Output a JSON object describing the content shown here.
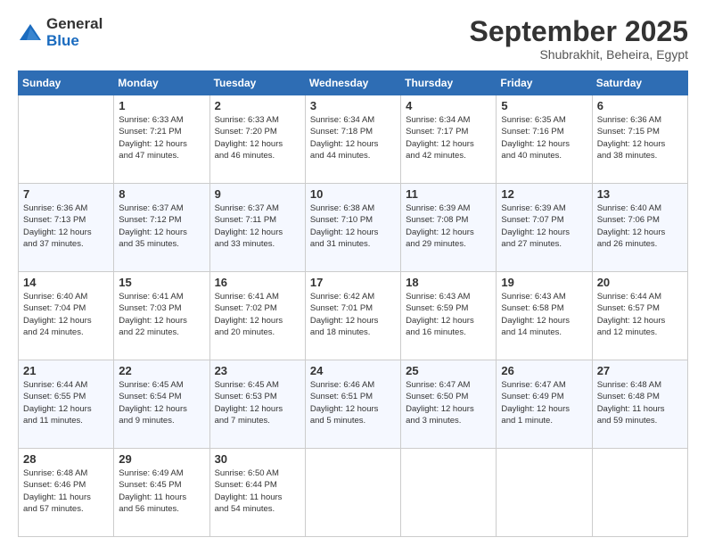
{
  "logo": {
    "general": "General",
    "blue": "Blue"
  },
  "header": {
    "month": "September 2025",
    "location": "Shubrakhit, Beheira, Egypt"
  },
  "days_header": [
    "Sunday",
    "Monday",
    "Tuesday",
    "Wednesday",
    "Thursday",
    "Friday",
    "Saturday"
  ],
  "weeks": [
    [
      {
        "day": "",
        "info": ""
      },
      {
        "day": "1",
        "info": "Sunrise: 6:33 AM\nSunset: 7:21 PM\nDaylight: 12 hours\nand 47 minutes."
      },
      {
        "day": "2",
        "info": "Sunrise: 6:33 AM\nSunset: 7:20 PM\nDaylight: 12 hours\nand 46 minutes."
      },
      {
        "day": "3",
        "info": "Sunrise: 6:34 AM\nSunset: 7:18 PM\nDaylight: 12 hours\nand 44 minutes."
      },
      {
        "day": "4",
        "info": "Sunrise: 6:34 AM\nSunset: 7:17 PM\nDaylight: 12 hours\nand 42 minutes."
      },
      {
        "day": "5",
        "info": "Sunrise: 6:35 AM\nSunset: 7:16 PM\nDaylight: 12 hours\nand 40 minutes."
      },
      {
        "day": "6",
        "info": "Sunrise: 6:36 AM\nSunset: 7:15 PM\nDaylight: 12 hours\nand 38 minutes."
      }
    ],
    [
      {
        "day": "7",
        "info": "Sunrise: 6:36 AM\nSunset: 7:13 PM\nDaylight: 12 hours\nand 37 minutes."
      },
      {
        "day": "8",
        "info": "Sunrise: 6:37 AM\nSunset: 7:12 PM\nDaylight: 12 hours\nand 35 minutes."
      },
      {
        "day": "9",
        "info": "Sunrise: 6:37 AM\nSunset: 7:11 PM\nDaylight: 12 hours\nand 33 minutes."
      },
      {
        "day": "10",
        "info": "Sunrise: 6:38 AM\nSunset: 7:10 PM\nDaylight: 12 hours\nand 31 minutes."
      },
      {
        "day": "11",
        "info": "Sunrise: 6:39 AM\nSunset: 7:08 PM\nDaylight: 12 hours\nand 29 minutes."
      },
      {
        "day": "12",
        "info": "Sunrise: 6:39 AM\nSunset: 7:07 PM\nDaylight: 12 hours\nand 27 minutes."
      },
      {
        "day": "13",
        "info": "Sunrise: 6:40 AM\nSunset: 7:06 PM\nDaylight: 12 hours\nand 26 minutes."
      }
    ],
    [
      {
        "day": "14",
        "info": "Sunrise: 6:40 AM\nSunset: 7:04 PM\nDaylight: 12 hours\nand 24 minutes."
      },
      {
        "day": "15",
        "info": "Sunrise: 6:41 AM\nSunset: 7:03 PM\nDaylight: 12 hours\nand 22 minutes."
      },
      {
        "day": "16",
        "info": "Sunrise: 6:41 AM\nSunset: 7:02 PM\nDaylight: 12 hours\nand 20 minutes."
      },
      {
        "day": "17",
        "info": "Sunrise: 6:42 AM\nSunset: 7:01 PM\nDaylight: 12 hours\nand 18 minutes."
      },
      {
        "day": "18",
        "info": "Sunrise: 6:43 AM\nSunset: 6:59 PM\nDaylight: 12 hours\nand 16 minutes."
      },
      {
        "day": "19",
        "info": "Sunrise: 6:43 AM\nSunset: 6:58 PM\nDaylight: 12 hours\nand 14 minutes."
      },
      {
        "day": "20",
        "info": "Sunrise: 6:44 AM\nSunset: 6:57 PM\nDaylight: 12 hours\nand 12 minutes."
      }
    ],
    [
      {
        "day": "21",
        "info": "Sunrise: 6:44 AM\nSunset: 6:55 PM\nDaylight: 12 hours\nand 11 minutes."
      },
      {
        "day": "22",
        "info": "Sunrise: 6:45 AM\nSunset: 6:54 PM\nDaylight: 12 hours\nand 9 minutes."
      },
      {
        "day": "23",
        "info": "Sunrise: 6:45 AM\nSunset: 6:53 PM\nDaylight: 12 hours\nand 7 minutes."
      },
      {
        "day": "24",
        "info": "Sunrise: 6:46 AM\nSunset: 6:51 PM\nDaylight: 12 hours\nand 5 minutes."
      },
      {
        "day": "25",
        "info": "Sunrise: 6:47 AM\nSunset: 6:50 PM\nDaylight: 12 hours\nand 3 minutes."
      },
      {
        "day": "26",
        "info": "Sunrise: 6:47 AM\nSunset: 6:49 PM\nDaylight: 12 hours\nand 1 minute."
      },
      {
        "day": "27",
        "info": "Sunrise: 6:48 AM\nSunset: 6:48 PM\nDaylight: 11 hours\nand 59 minutes."
      }
    ],
    [
      {
        "day": "28",
        "info": "Sunrise: 6:48 AM\nSunset: 6:46 PM\nDaylight: 11 hours\nand 57 minutes."
      },
      {
        "day": "29",
        "info": "Sunrise: 6:49 AM\nSunset: 6:45 PM\nDaylight: 11 hours\nand 56 minutes."
      },
      {
        "day": "30",
        "info": "Sunrise: 6:50 AM\nSunset: 6:44 PM\nDaylight: 11 hours\nand 54 minutes."
      },
      {
        "day": "",
        "info": ""
      },
      {
        "day": "",
        "info": ""
      },
      {
        "day": "",
        "info": ""
      },
      {
        "day": "",
        "info": ""
      }
    ]
  ]
}
